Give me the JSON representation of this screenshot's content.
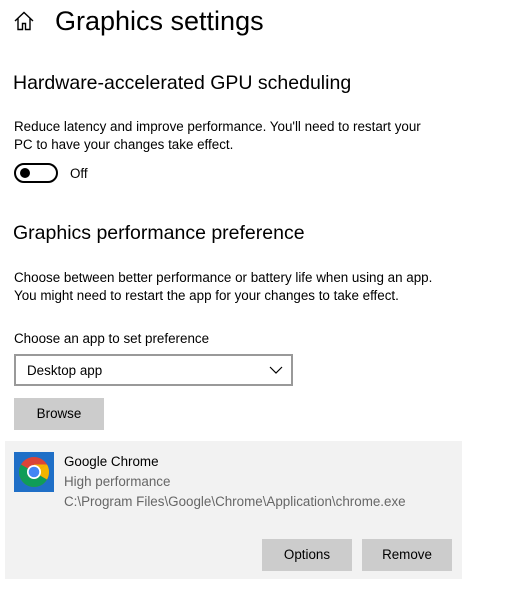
{
  "header": {
    "home_icon": "home-icon",
    "title": "Graphics settings"
  },
  "gpu_scheduling": {
    "heading": "Hardware-accelerated GPU scheduling",
    "description_line1": "Reduce latency and improve performance. You'll need to restart your",
    "description_line2": "PC to have your changes take effect.",
    "toggle_on": false,
    "toggle_label": "Off"
  },
  "performance_preference": {
    "heading": "Graphics performance preference",
    "description_line1": "Choose between better performance or battery life when using an app.",
    "description_line2": "You might need to restart the app for your changes to take effect.",
    "choose_label": "Choose an app to set preference",
    "dropdown_value": "Desktop app",
    "browse_label": "Browse"
  },
  "app_entry": {
    "icon": "chrome-icon",
    "name": "Google Chrome",
    "preference": "High performance",
    "path": "C:\\Program Files\\Google\\Chrome\\Application\\chrome.exe",
    "options_label": "Options",
    "remove_label": "Remove"
  },
  "colors": {
    "card_background": "#f2f2f2",
    "button_background": "#cccccc",
    "secondary_text": "#666666",
    "chrome_tile": "#1f6fc7"
  }
}
